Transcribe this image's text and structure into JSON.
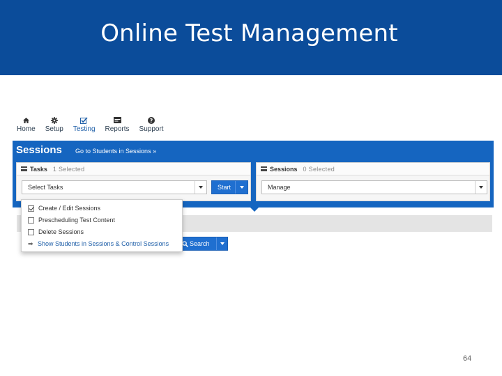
{
  "slide": {
    "title": "Online Test Management",
    "page_number": "64"
  },
  "nav": {
    "items": [
      {
        "label": "Home",
        "icon": "home-icon"
      },
      {
        "label": "Setup",
        "icon": "gear-icon"
      },
      {
        "label": "Testing",
        "icon": "checkbox-icon"
      },
      {
        "label": "Reports",
        "icon": "report-icon"
      },
      {
        "label": "Support",
        "icon": "help-icon"
      }
    ]
  },
  "sessions": {
    "title": "Sessions",
    "goto_link": "Go to Students in Sessions »"
  },
  "tasks_card": {
    "label": "Tasks",
    "count": "1 Selected",
    "select_value": "Select Tasks",
    "start_label": "Start"
  },
  "sessions_card": {
    "label": "Sessions",
    "count": "0 Selected",
    "select_value": "Manage"
  },
  "dropdown": {
    "items": [
      {
        "label": "Create / Edit Sessions",
        "checked": true
      },
      {
        "label": "Prescheduling Test Content",
        "checked": false
      },
      {
        "label": "Delete Sessions",
        "checked": false
      },
      {
        "label": "Show Students in Sessions & Control Sessions",
        "link": true
      }
    ]
  },
  "search": {
    "label": "Search"
  },
  "colors": {
    "title_band": "#0b4c9a",
    "panel_blue": "#1565c0",
    "button_blue": "#1f6fd0"
  }
}
